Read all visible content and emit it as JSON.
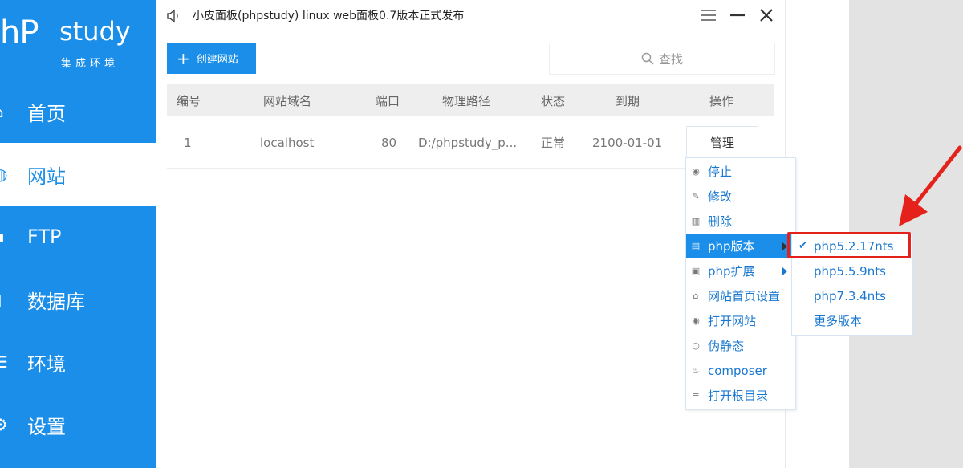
{
  "sidebar": {
    "logo_main": "hP",
    "logo_study": "study",
    "logo_sub": "集成环境",
    "items": [
      {
        "label": "首页",
        "icon": "home-icon"
      },
      {
        "label": "网站",
        "icon": "globe-icon"
      },
      {
        "label": "FTP",
        "icon": "ftp-icon"
      },
      {
        "label": "数据库",
        "icon": "database-icon"
      },
      {
        "label": "环境",
        "icon": "environment-icon"
      },
      {
        "label": "设置",
        "icon": "gear-icon"
      }
    ],
    "active_index": 1
  },
  "titlebar": {
    "text": "小皮面板(phpstudy) linux web面板0.7版本正式发布",
    "icons": [
      "speaker-icon",
      "menu-icon",
      "minimize-icon",
      "close-icon"
    ]
  },
  "toolbar": {
    "create_label": "创建网站",
    "search_placeholder": "查找"
  },
  "table": {
    "headers": [
      "编号",
      "网站域名",
      "端口",
      "物理路径",
      "状态",
      "到期",
      "操作"
    ],
    "rows": [
      {
        "id": "1",
        "domain": "localhost",
        "port": "80",
        "path": "D:/phpstudy_p...",
        "status": "正常",
        "expire": "2100-01-01",
        "action": "管理"
      }
    ]
  },
  "context_menu": {
    "items": [
      {
        "label": "停止",
        "icon": "stop-icon"
      },
      {
        "label": "修改",
        "icon": "pencil-icon"
      },
      {
        "label": "删除",
        "icon": "trash-icon"
      },
      {
        "label": "php版本",
        "icon": "php-icon",
        "submenu": true,
        "highlighted": true
      },
      {
        "label": "php扩展",
        "icon": "extension-icon",
        "submenu": true
      },
      {
        "label": "网站首页设置",
        "icon": "home-icon"
      },
      {
        "label": "打开网站",
        "icon": "open-site-icon"
      },
      {
        "label": "伪静态",
        "icon": "rewrite-icon"
      },
      {
        "label": "composer",
        "icon": "composer-icon"
      },
      {
        "label": "打开根目录",
        "icon": "folder-list-icon"
      }
    ]
  },
  "submenu": {
    "items": [
      {
        "label": "php5.2.17nts",
        "checked": true
      },
      {
        "label": "php5.5.9nts",
        "checked": false
      },
      {
        "label": "php7.3.4nts",
        "checked": false
      },
      {
        "label": "更多版本",
        "checked": false
      }
    ]
  },
  "colors": {
    "brand_blue": "#1a8ee8",
    "menu_text": "#1a78d0",
    "annotation_red": "#e4221b"
  }
}
